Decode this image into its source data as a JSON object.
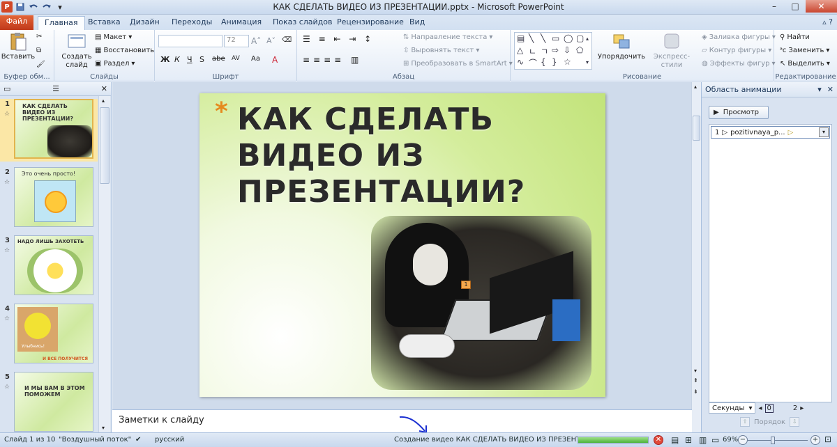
{
  "window": {
    "title": "КАК СДЕЛАТЬ ВИДЕО ИЗ ПРЕЗЕНТАЦИИ.pptx - Microsoft PowerPoint",
    "app_icon": "P",
    "qat": {
      "save_icon": "save-icon",
      "undo_icon": "undo-icon",
      "redo_icon": "redo-icon"
    },
    "minimize": "–",
    "maximize": "□",
    "close": "✕"
  },
  "tabs": {
    "file": "Файл",
    "home": "Главная",
    "insert": "Вставка",
    "design": "Дизайн",
    "transitions": "Переходы",
    "animation": "Анимация",
    "slideshow": "Показ слайдов",
    "review": "Рецензирование",
    "view": "Вид"
  },
  "ribbon": {
    "clipboard": {
      "label": "Буфер обм...",
      "paste": "Вставить"
    },
    "slides": {
      "label": "Слайды",
      "new_slide_line1": "Создать",
      "new_slide_line2": "слайд",
      "layout": "Макет",
      "reset": "Восстановить",
      "section": "Раздел"
    },
    "font": {
      "label": "Шрифт",
      "font_size": "72",
      "bold": "Ж",
      "italic": "К",
      "underline": "Ч",
      "strike": "S",
      "shadow": "abe",
      "spacing": "AV",
      "case": "Aa",
      "color": "A"
    },
    "paragraph": {
      "label": "Абзац",
      "text_direction": "Направление текста",
      "align_text": "Выровнять текст",
      "smartart": "Преобразовать в SmartArt"
    },
    "drawing": {
      "label": "Рисование",
      "arrange": "Упорядочить",
      "quick_styles": "Экспресс-стили",
      "shape_fill": "Заливка фигуры",
      "shape_outline": "Контур фигуры",
      "shape_effects": "Эффекты фигур"
    },
    "editing": {
      "label": "Редактирование",
      "find": "Найти",
      "replace": "Заменить",
      "select": "Выделить"
    }
  },
  "thumbnails": [
    {
      "num": "1",
      "text": "КАК СДЕЛАТЬ\nВИДЕО ИЗ\nПРЕЗЕНТАЦИИ?",
      "selected": true
    },
    {
      "num": "2",
      "text": "Это очень просто!",
      "selected": false
    },
    {
      "num": "3",
      "text": "НАДО ЛИШЬ ЗАХОТЕТЬ",
      "selected": false
    },
    {
      "num": "4",
      "text": "И ВСЕ ПОЛУЧИТСЯ",
      "extra": "Улыбнись!",
      "selected": false
    },
    {
      "num": "5",
      "text": "И МЫ ВАМ В ЭТОМ\nПОМОЖЕМ",
      "selected": false
    }
  ],
  "slide": {
    "bullet": "*",
    "title": "КАК СДЕЛАТЬ\nВИДЕО ИЗ\nПРЕЗЕНТАЦИИ?",
    "anim_tag": "1"
  },
  "notes": {
    "placeholder": "Заметки к слайду"
  },
  "animation_pane": {
    "title": "Область анимации",
    "preview": "Просмотр",
    "item_num": "1",
    "item_name": "pozitivnaya_p...",
    "seconds": "Секунды",
    "timeline_start": "0",
    "timeline_end": "2",
    "order": "Порядок"
  },
  "status": {
    "slide": "Слайд 1 из 10",
    "theme": "\"Воздушный поток\"",
    "language": "русский",
    "task": "Создание видео КАК СДЕЛАТЬ ВИДЕО ИЗ ПРЕЗЕНТАЦИИ.wmv",
    "progress": 1.0,
    "zoom": "69%"
  }
}
